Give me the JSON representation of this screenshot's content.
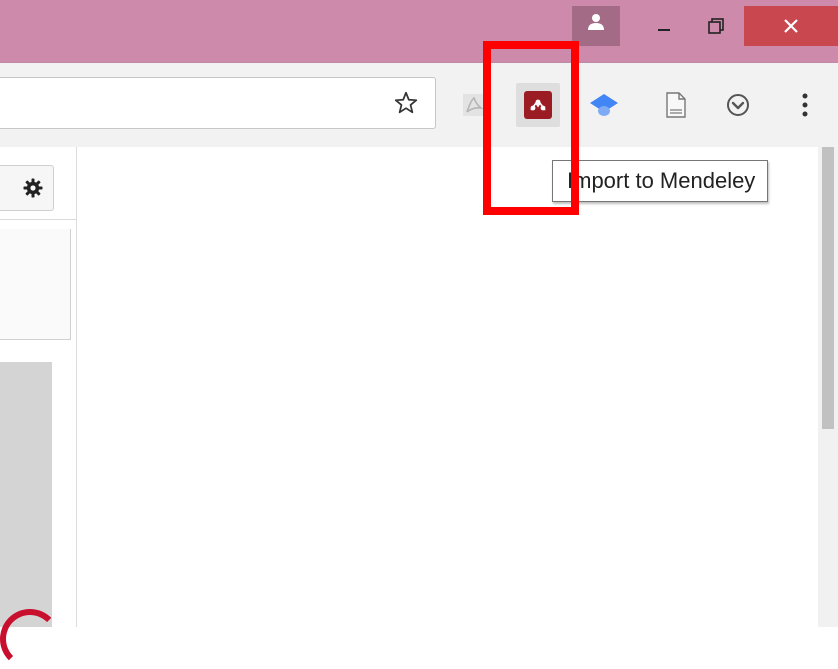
{
  "window": {
    "profile_icon": "person-icon",
    "minimize_icon": "minimize-icon",
    "maximize_icon": "restore-icon",
    "close_icon": "close-icon"
  },
  "toolbar": {
    "bookmark_icon": "star-icon",
    "extensions": [
      {
        "icon": "pdf-icon"
      },
      {
        "icon": "mendeley-icon"
      },
      {
        "icon": "scholar-cap-icon"
      },
      {
        "icon": "document-icon"
      },
      {
        "icon": "pocket-icon"
      }
    ],
    "menu_icon": "kebab-menu-icon"
  },
  "tooltip": {
    "text": "Import to Mendeley"
  },
  "page": {
    "settings_icon": "gear-icon"
  },
  "colors": {
    "titlebar": "#cd8aab",
    "close_button": "#c9484f",
    "mendeley": "#9c1c23",
    "highlight": "#ff0000",
    "scholar": "#4285f4"
  }
}
